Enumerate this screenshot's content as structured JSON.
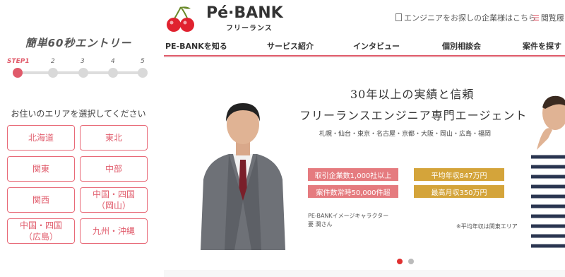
{
  "entry_panel": {
    "title": "簡単60秒エントリー",
    "steps": [
      "STEP1",
      "2",
      "3",
      "4",
      "5"
    ],
    "active_step": 1,
    "question": "お住いのエリアを選択してください",
    "areas": [
      "北海道",
      "東北",
      "関東",
      "中部",
      "関西",
      "中国・四国\n（岡山）",
      "中国・四国\n（広島）",
      "九州・沖縄"
    ]
  },
  "header": {
    "logo_main": "Pé·BANK",
    "logo_sub": "フリーランス",
    "company_link": "エンジニアをお探しの企業様はこちら",
    "history_link": "閲覧履"
  },
  "nav": {
    "items": [
      "PE-BANKを知る",
      "サービス紹介",
      "インタビュー",
      "個別相談会",
      "案件を探す"
    ]
  },
  "hero": {
    "title_line1": "30年以上の実績と信頼",
    "title_line2": "フリーランスエンジニア専門エージェント",
    "cities": "札幌・仙台・東京・名古屋・京都・大阪・岡山・広島・福岡",
    "badges": [
      "取引企業数1,000社以上",
      "平均年収847万円",
      "案件数常時50,000件超",
      "最高月収350万円"
    ],
    "note_character": "PE-BANKイメージキャラクター",
    "note_name": "要 潤さん",
    "note_income": "※平均年収は関東エリア"
  },
  "carousel": {
    "count": 2,
    "active": 0
  },
  "colors": {
    "accent": "#e05a6a",
    "gold": "#d4a43a",
    "badge_red": "#e57b7f"
  }
}
